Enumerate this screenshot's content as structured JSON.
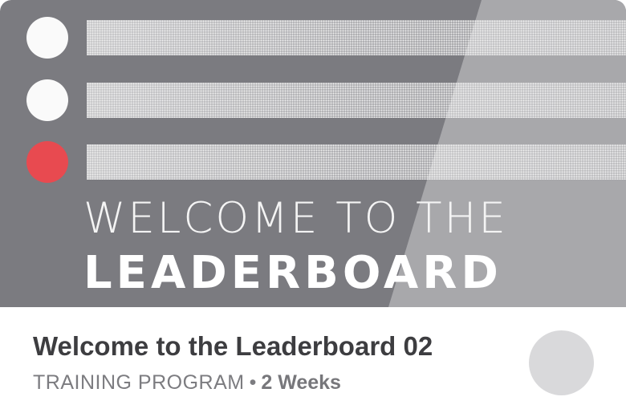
{
  "card": {
    "hero": {
      "line1": "WELCOME TO THE",
      "line2": "LEADERBOARD",
      "rows": [
        {
          "status": "white"
        },
        {
          "status": "white"
        },
        {
          "status": "red"
        }
      ],
      "colors": {
        "background": "#7b7b80",
        "diagonal": "#a8a8ab",
        "dot": "#fafafa",
        "dot_highlight": "#e84a50"
      }
    },
    "title": "Welcome to the Leaderboard 02",
    "type": "TRAINING PROGRAM",
    "separator": "•",
    "duration": "2 Weeks",
    "avatar": {
      "color": "#d9d9db"
    }
  }
}
